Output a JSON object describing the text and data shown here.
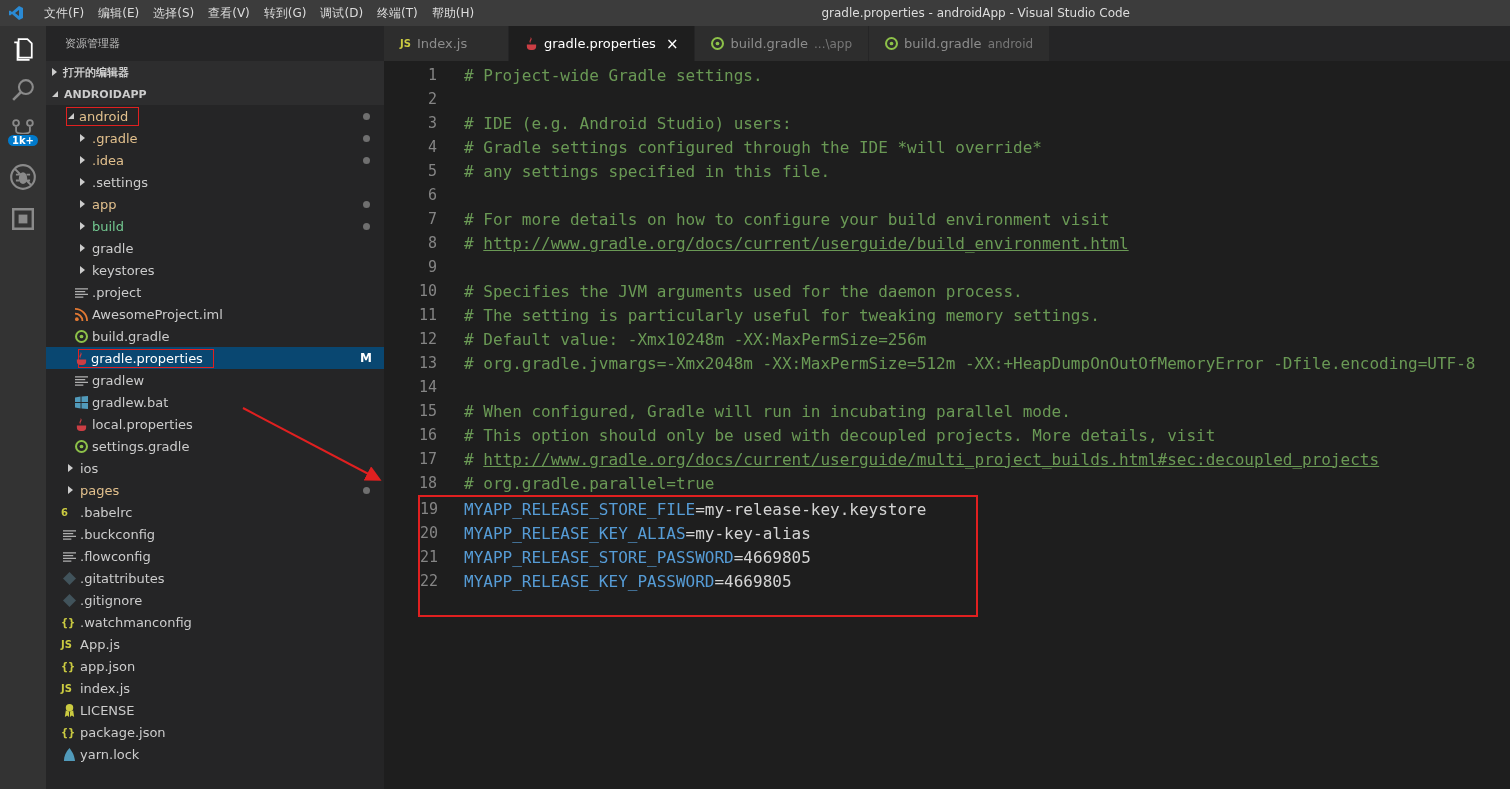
{
  "menu": [
    "文件(F)",
    "编辑(E)",
    "选择(S)",
    "查看(V)",
    "转到(G)",
    "调试(D)",
    "终端(T)",
    "帮助(H)"
  ],
  "window": {
    "title": "gradle.properties - androidApp - Visual Studio Code"
  },
  "activity_bar": [
    {
      "kind": "files",
      "selected": true
    },
    {
      "kind": "search",
      "selected": false
    },
    {
      "kind": "scm",
      "selected": false,
      "badge": "1k+"
    },
    {
      "kind": "debug",
      "selected": false
    },
    {
      "kind": "extensions",
      "selected": false
    }
  ],
  "explorer": {
    "title": "资源管理器",
    "sections": [
      {
        "label": "打开的编辑器",
        "expanded": false
      },
      {
        "label": "ANDROIDAPP",
        "expanded": true
      }
    ],
    "tree": [
      {
        "name": "android",
        "kind": "folder",
        "expanded": true,
        "color": "#e2c08d",
        "dot": true,
        "annotated": true,
        "selected": false,
        "children": [
          {
            "name": ".gradle",
            "kind": "folder",
            "expanded": false,
            "color": "#e2c08d",
            "dot": true,
            "annotated": false,
            "selected": false
          },
          {
            "name": ".idea",
            "kind": "folder",
            "expanded": false,
            "color": "#e2c08d",
            "dot": true,
            "annotated": false,
            "selected": false
          },
          {
            "name": ".settings",
            "kind": "folder",
            "expanded": false,
            "color": "#cccccc",
            "dot": false,
            "annotated": false,
            "selected": false
          },
          {
            "name": "app",
            "kind": "folder",
            "expanded": false,
            "color": "#e2c08d",
            "dot": true,
            "annotated": false,
            "selected": false
          },
          {
            "name": "build",
            "kind": "folder",
            "expanded": false,
            "color": "#73c991",
            "dot": true,
            "annotated": false,
            "selected": false
          },
          {
            "name": "gradle",
            "kind": "folder",
            "expanded": false,
            "color": "#cccccc",
            "dot": false,
            "annotated": false,
            "selected": false
          },
          {
            "name": "keystores",
            "kind": "folder",
            "expanded": false,
            "color": "#cccccc",
            "dot": false,
            "annotated": false,
            "selected": false
          },
          {
            "name": ".project",
            "kind": "text",
            "color": "#cccccc",
            "dot": false,
            "annotated": false,
            "selected": false
          },
          {
            "name": "AwesomeProject.iml",
            "kind": "rss",
            "color": "#cccccc",
            "dot": false,
            "annotated": false,
            "selected": false
          },
          {
            "name": "build.gradle",
            "kind": "gradle",
            "color": "#cccccc",
            "dot": false,
            "annotated": false,
            "selected": false
          },
          {
            "name": "gradle.properties",
            "kind": "java",
            "color": "#ffffff",
            "dot": false,
            "annotated": true,
            "selected": true,
            "badge": "M"
          },
          {
            "name": "gradlew",
            "kind": "text",
            "color": "#cccccc",
            "dot": false,
            "annotated": false,
            "selected": false
          },
          {
            "name": "gradlew.bat",
            "kind": "windows",
            "color": "#cccccc",
            "dot": false,
            "annotated": false,
            "selected": false
          },
          {
            "name": "local.properties",
            "kind": "java",
            "color": "#cccccc",
            "dot": false,
            "annotated": false,
            "selected": false
          },
          {
            "name": "settings.gradle",
            "kind": "gradle",
            "color": "#cccccc",
            "dot": false,
            "annotated": false,
            "selected": false
          }
        ]
      },
      {
        "name": "ios",
        "kind": "folder",
        "expanded": false,
        "color": "#cccccc",
        "dot": false,
        "annotated": false,
        "selected": false
      },
      {
        "name": "pages",
        "kind": "folder",
        "expanded": false,
        "color": "#e2c08d",
        "dot": true,
        "annotated": false,
        "selected": false
      },
      {
        "name": ".babelrc",
        "kind": "babel",
        "glyph": "6",
        "color": "#cccccc",
        "dot": false,
        "annotated": false,
        "selected": false
      },
      {
        "name": ".buckconfig",
        "kind": "text",
        "color": "#cccccc",
        "dot": false,
        "annotated": false,
        "selected": false
      },
      {
        "name": ".flowconfig",
        "kind": "text",
        "color": "#cccccc",
        "dot": false,
        "annotated": false,
        "selected": false
      },
      {
        "name": ".gitattributes",
        "kind": "git",
        "color": "#cccccc",
        "dot": false,
        "annotated": false,
        "selected": false
      },
      {
        "name": ".gitignore",
        "kind": "git",
        "color": "#cccccc",
        "dot": false,
        "annotated": false,
        "selected": false
      },
      {
        "name": ".watchmanconfig",
        "kind": "json",
        "glyph": "{}",
        "color": "#cccccc",
        "dot": false,
        "annotated": false,
        "selected": false
      },
      {
        "name": "App.js",
        "kind": "js",
        "glyph": "JS",
        "color": "#cccccc",
        "dot": false,
        "annotated": false,
        "selected": false
      },
      {
        "name": "app.json",
        "kind": "json",
        "glyph": "{}",
        "color": "#cccccc",
        "dot": false,
        "annotated": false,
        "selected": false
      },
      {
        "name": "index.js",
        "kind": "js",
        "glyph": "JS",
        "color": "#cccccc",
        "dot": false,
        "annotated": false,
        "selected": false
      },
      {
        "name": "LICENSE",
        "kind": "license",
        "color": "#cccccc",
        "dot": false,
        "annotated": false,
        "selected": false
      },
      {
        "name": "package.json",
        "kind": "json",
        "glyph": "{}",
        "color": "#cccccc",
        "dot": false,
        "annotated": false,
        "selected": false
      },
      {
        "name": "yarn.lock",
        "kind": "yarn",
        "color": "#cccccc",
        "dot": false,
        "annotated": false,
        "selected": false
      }
    ]
  },
  "tabs": [
    {
      "label": "Index.js",
      "kind": "js",
      "glyph": "JS",
      "selected": false
    },
    {
      "label": "gradle.properties",
      "kind": "java",
      "selected": true,
      "close": "×"
    },
    {
      "label": "build.gradle",
      "description": "...\\app",
      "kind": "gradle",
      "selected": false
    },
    {
      "label": "build.gradle",
      "description": "android",
      "kind": "gradle",
      "selected": false
    }
  ],
  "editor": {
    "lines": [
      {
        "number": "1",
        "kind": "comment",
        "text": "# Project-wide Gradle settings."
      },
      {
        "number": "2",
        "kind": "blank"
      },
      {
        "number": "3",
        "kind": "comment",
        "text": "# IDE (e.g. Android Studio) users:"
      },
      {
        "number": "4",
        "kind": "comment",
        "text": "# Gradle settings configured through the IDE *will override*"
      },
      {
        "number": "5",
        "kind": "comment",
        "text": "# any settings specified in this file."
      },
      {
        "number": "6",
        "kind": "blank"
      },
      {
        "number": "7",
        "kind": "comment",
        "text": "# For more details on how to configure your build environment visit"
      },
      {
        "number": "8",
        "kind": "link",
        "text": "#",
        "link": "http://www.gradle.org/docs/current/userguide/build_environment.html"
      },
      {
        "number": "9",
        "kind": "blank"
      },
      {
        "number": "10",
        "kind": "comment",
        "text": "# Specifies the JVM arguments used for the daemon process."
      },
      {
        "number": "11",
        "kind": "comment",
        "text": "# The setting is particularly useful for tweaking memory settings."
      },
      {
        "number": "12",
        "kind": "comment",
        "text": "# Default value: -Xmx10248m -XX:MaxPermSize=256m"
      },
      {
        "number": "13",
        "kind": "comment",
        "text": "# org.gradle.jvmargs=-Xmx2048m -XX:MaxPermSize=512m -XX:+HeapDumpOnOutOfMemoryError -Dfile.encoding=UTF-8"
      },
      {
        "number": "14",
        "kind": "blank"
      },
      {
        "number": "15",
        "kind": "comment",
        "text": "# When configured, Gradle will run in incubating parallel mode."
      },
      {
        "number": "16",
        "kind": "comment",
        "text": "# This option should only be used with decoupled projects. More details, visit"
      },
      {
        "number": "17",
        "kind": "link",
        "text": "#",
        "link": "http://www.gradle.org/docs/current/userguide/multi_project_builds.html#sec:decoupled_projects"
      },
      {
        "number": "18",
        "kind": "comment",
        "text": "# org.gradle.parallel=true"
      }
    ],
    "highlighted_lines": [
      {
        "number": "19",
        "kind": "property",
        "key": "MYAPP_RELEASE_STORE_FILE",
        "separator": "=",
        "value": "my-release-key.keystore"
      },
      {
        "number": "20",
        "kind": "property",
        "key": "MYAPP_RELEASE_KEY_ALIAS",
        "separator": "=",
        "value": "my-key-alias"
      },
      {
        "number": "21",
        "kind": "property",
        "key": "MYAPP_RELEASE_STORE_PASSWORD",
        "separator": "=",
        "value": "4669805"
      },
      {
        "number": "22",
        "kind": "property",
        "key": "MYAPP_RELEASE_KEY_PASSWORD",
        "separator": "=",
        "value": "4669805"
      }
    ]
  }
}
